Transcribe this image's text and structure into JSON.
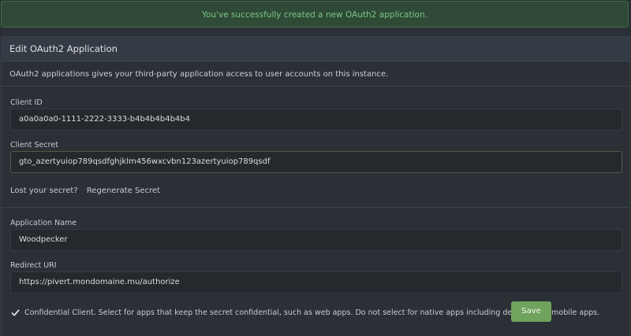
{
  "flash": {
    "message": "You've successfully created a new OAuth2 application."
  },
  "panel": {
    "title": "Edit OAuth2 Application",
    "intro": "OAuth2 applications gives your third-party application access to user accounts on this instance."
  },
  "client_id": {
    "label": "Client ID",
    "value": "a0a0a0a0-1111-2222-3333-b4b4b4b4b4b4"
  },
  "client_secret": {
    "label": "Client Secret",
    "value": "gto_azertyuiop789qsdfghjklm456wxcvbn123azertyuiop789qsdf"
  },
  "secret_help": {
    "text": "Lost your secret?",
    "regenerate_label": "Regenerate Secret"
  },
  "app_name": {
    "label": "Application Name",
    "value": "Woodpecker"
  },
  "redirect_uri": {
    "label": "Redirect URI",
    "value": "https://pivert.mondomaine.mu/authorize"
  },
  "confidential": {
    "checked": true,
    "label": "Confidential Client. Select for apps that keep the secret confidential, such as web apps. Do not select for native apps including desktop and mobile apps."
  },
  "save_label": "Save",
  "colors": {
    "success_bg": "#2f4a36",
    "success_text": "#7cc58a",
    "accent": "#6fa35e",
    "background": "#2b3036"
  },
  "icons": {
    "confidential_check": "checkmark-icon"
  }
}
